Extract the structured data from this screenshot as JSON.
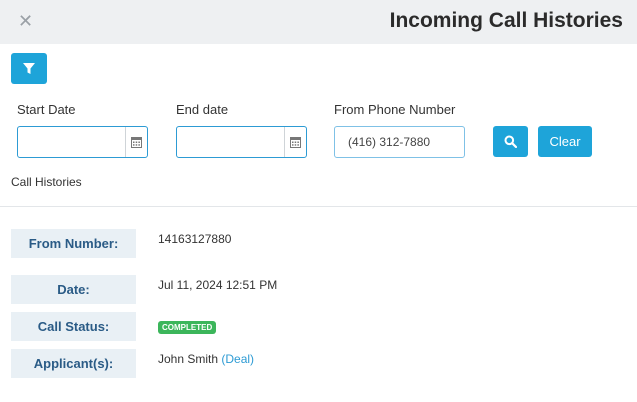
{
  "header": {
    "close_icon": "close-icon",
    "title": "Incoming Call Histories"
  },
  "toolbar": {
    "filter_icon": "filter-icon"
  },
  "filters": {
    "start_date_label": "Start Date",
    "start_date_value": "",
    "end_date_label": "End date",
    "end_date_value": "",
    "from_phone_label": "From Phone Number",
    "from_phone_value": "(416) 312-7880",
    "search_icon": "search-icon",
    "clear_label": "Clear"
  },
  "section": {
    "label": "Call Histories"
  },
  "details": {
    "from_number_label": "From Number:",
    "from_number_value": "14163127880",
    "date_label": "Date:",
    "date_value": "Jul 11, 2024 12:51 PM",
    "call_status_label": "Call Status:",
    "call_status_value": "COMPLETED",
    "applicants_label": "Applicant(s):",
    "applicant_name": "John Smith",
    "applicant_link": "(Deal)"
  },
  "colors": {
    "accent": "#1ea4d9",
    "status_completed": "#3cb65b",
    "label_bg": "#e9f0f5",
    "label_text": "#2a5b86"
  }
}
